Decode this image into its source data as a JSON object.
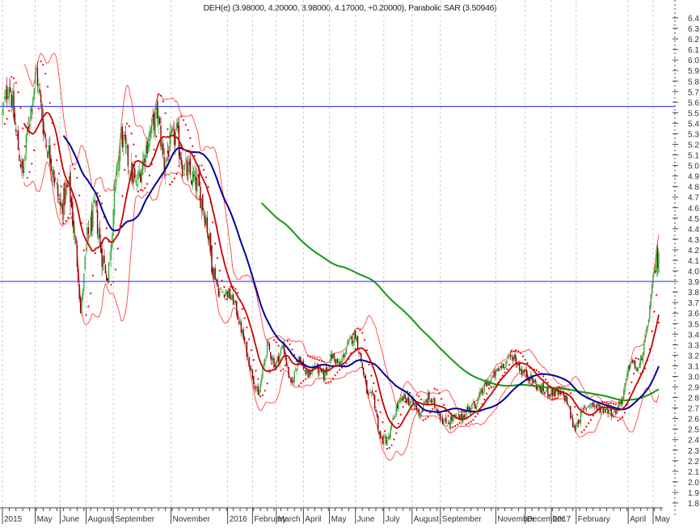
{
  "chart_data": {
    "type": "line",
    "title": "DEH(e) (3.98000, 4.20000, 3.98000, 4.17000, +0.20000), Parabolic SAR (3.50946)",
    "ohlc_last": {
      "open": 3.98,
      "high": 4.2,
      "low": 3.98,
      "close": 4.17,
      "change": 0.2
    },
    "sar_last": 3.50946,
    "ylim": [
      1.8,
      6.4
    ],
    "y_ticks": [
      "6.4",
      "6.3",
      "6.2",
      "6.1",
      "6.0",
      "5.9",
      "5.8",
      "5.7",
      "5.6",
      "5.5",
      "5.4",
      "5.3",
      "5.2",
      "5.1",
      "5.0",
      "4.9",
      "4.8",
      "4.7",
      "4.6",
      "4.5",
      "4.4",
      "4.3",
      "4.2",
      "4.1",
      "4.0",
      "3.9",
      "3.8",
      "3.7",
      "3.6",
      "3.5",
      "3.4",
      "3.3",
      "3.2",
      "3.1",
      "3.0",
      "2.9",
      "2.8",
      "2.7",
      "2.6",
      "2.5",
      "2.4",
      "2.3",
      "2.2",
      "2.1",
      "2.0",
      "1.9",
      "1.8"
    ],
    "x_unit": "trading-bar index",
    "xlim": [
      0,
      582
    ],
    "x_ticks": [
      {
        "label": "2015",
        "t": 0
      },
      {
        "label": "May",
        "t": 29
      },
      {
        "label": "June",
        "t": 51
      },
      {
        "label": "August",
        "t": 74
      },
      {
        "label": "September",
        "t": 98
      },
      {
        "label": "November",
        "t": 149
      },
      {
        "label": "2016",
        "t": 199
      },
      {
        "label": "February",
        "t": 221
      },
      {
        "label": "March",
        "t": 242
      },
      {
        "label": "April",
        "t": 266
      },
      {
        "label": "May",
        "t": 289
      },
      {
        "label": "June",
        "t": 312
      },
      {
        "label": "July",
        "t": 337
      },
      {
        "label": "August",
        "t": 362
      },
      {
        "label": "September",
        "t": 387
      },
      {
        "label": "November",
        "t": 436
      },
      {
        "label": "December",
        "t": 462
      },
      {
        "label": "2017",
        "t": 485
      },
      {
        "label": "February",
        "t": 507
      },
      {
        "label": "April",
        "t": 553
      },
      {
        "label": "May",
        "t": 575
      }
    ],
    "horizontal_lines": [
      5.56,
      3.9
    ],
    "indicators": {
      "ma_short": 20,
      "ma_mid": 55,
      "ma_long": 230,
      "bollinger": {
        "period": 20,
        "stddev": 2
      },
      "sar": {
        "step": 0.02,
        "max": 0.2
      }
    },
    "colors": {
      "up": "#3aa83a",
      "down": "#8b0000",
      "ma_short": "#cc0000",
      "ma_mid": "#000099",
      "ma_long": "#119911",
      "bands": "#ff5555",
      "sar": "#ee0000",
      "hline": "#3a3aff"
    },
    "close_keypoints": [
      [
        0,
        5.5
      ],
      [
        6,
        5.8
      ],
      [
        12,
        5.3
      ],
      [
        18,
        4.9
      ],
      [
        23,
        5.4
      ],
      [
        30,
        5.9
      ],
      [
        37,
        5.3
      ],
      [
        44,
        5.0
      ],
      [
        51,
        4.6
      ],
      [
        59,
        4.8
      ],
      [
        66,
        4.1
      ],
      [
        69,
        3.6
      ],
      [
        75,
        4.3
      ],
      [
        82,
        4.6
      ],
      [
        87,
        4.2
      ],
      [
        93,
        3.9
      ],
      [
        98,
        4.6
      ],
      [
        105,
        5.3
      ],
      [
        112,
        5.0
      ],
      [
        118,
        4.8
      ],
      [
        123,
        5.0
      ],
      [
        130,
        5.3
      ],
      [
        137,
        5.5
      ],
      [
        143,
        5.0
      ],
      [
        148,
        5.2
      ],
      [
        154,
        5.3
      ],
      [
        159,
        5.0
      ],
      [
        166,
        4.9
      ],
      [
        173,
        4.8
      ],
      [
        180,
        4.5
      ],
      [
        185,
        4.1
      ],
      [
        191,
        3.8
      ],
      [
        198,
        3.8
      ],
      [
        205,
        3.7
      ],
      [
        212,
        3.4
      ],
      [
        219,
        3.1
      ],
      [
        226,
        2.8
      ],
      [
        234,
        3.3
      ],
      [
        241,
        3.1
      ],
      [
        248,
        3.3
      ],
      [
        255,
        2.9
      ],
      [
        262,
        3.2
      ],
      [
        269,
        3.0
      ],
      [
        276,
        3.1
      ],
      [
        284,
        3.0
      ],
      [
        291,
        3.2
      ],
      [
        298,
        3.1
      ],
      [
        305,
        3.3
      ],
      [
        312,
        3.4
      ],
      [
        316,
        3.2
      ],
      [
        323,
        2.8
      ],
      [
        328,
        2.8
      ],
      [
        334,
        2.4
      ],
      [
        341,
        2.4
      ],
      [
        348,
        2.7
      ],
      [
        355,
        2.8
      ],
      [
        362,
        2.75
      ],
      [
        369,
        2.65
      ],
      [
        376,
        2.8
      ],
      [
        384,
        2.7
      ],
      [
        391,
        2.55
      ],
      [
        398,
        2.6
      ],
      [
        405,
        2.6
      ],
      [
        412,
        2.7
      ],
      [
        419,
        2.75
      ],
      [
        426,
        2.9
      ],
      [
        434,
        3.0
      ],
      [
        441,
        3.1
      ],
      [
        451,
        3.2
      ],
      [
        459,
        3.05
      ],
      [
        466,
        3.0
      ],
      [
        473,
        2.9
      ],
      [
        480,
        2.85
      ],
      [
        487,
        2.85
      ],
      [
        498,
        2.8
      ],
      [
        505,
        2.5
      ],
      [
        512,
        2.65
      ],
      [
        519,
        2.75
      ],
      [
        526,
        2.7
      ],
      [
        534,
        2.7
      ],
      [
        541,
        2.65
      ],
      [
        548,
        2.8
      ],
      [
        555,
        3.15
      ],
      [
        562,
        3.05
      ],
      [
        569,
        3.4
      ],
      [
        573,
        3.75
      ],
      [
        576,
        4.0
      ],
      [
        580,
        4.17
      ]
    ]
  }
}
